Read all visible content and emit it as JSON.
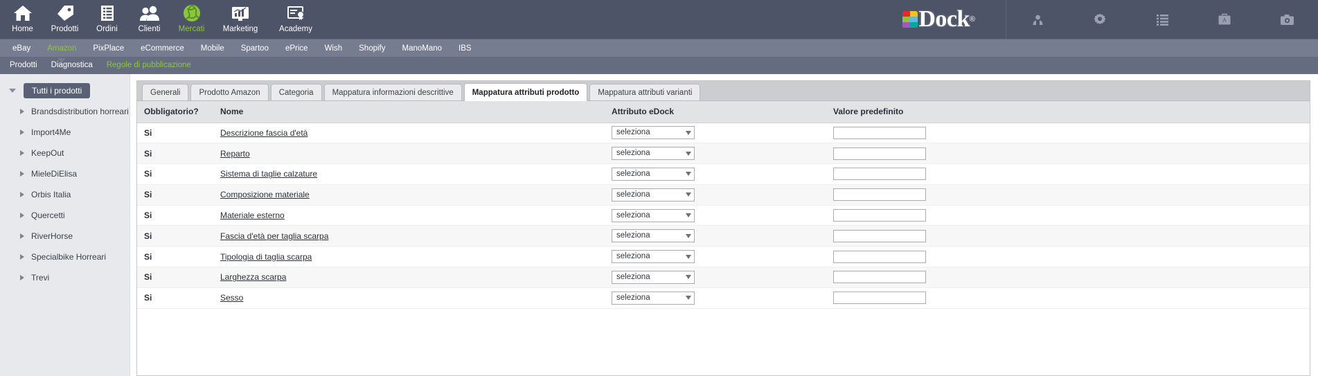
{
  "topnav": {
    "items": [
      {
        "label": "Home",
        "icon": "home-icon",
        "active": false
      },
      {
        "label": "Prodotti",
        "icon": "tag-icon",
        "active": false
      },
      {
        "label": "Ordini",
        "icon": "list-document-icon",
        "active": false
      },
      {
        "label": "Clienti",
        "icon": "users-icon",
        "active": false
      },
      {
        "label": "Mercati",
        "icon": "globe-green-icon",
        "active": true
      },
      {
        "label": "Marketing",
        "icon": "chart-monitor-icon",
        "active": false
      },
      {
        "label": "Academy",
        "icon": "certificate-icon",
        "active": false
      }
    ],
    "logo": {
      "word": "Dock",
      "registered": "®",
      "tile_colors": [
        "#e8282d",
        "#f6c11a",
        "#8cc63e",
        "#5fb8e8",
        "#a855c4",
        "#00a99d"
      ]
    },
    "right_icons": [
      {
        "name": "user-account-icon"
      },
      {
        "name": "gear-settings-icon"
      },
      {
        "name": "list-menu-icon"
      },
      {
        "name": "briefcase-icon"
      },
      {
        "name": "camera-icon"
      }
    ]
  },
  "marketnav": {
    "items": [
      {
        "label": "eBay",
        "active": false
      },
      {
        "label": "Amazon",
        "active": true
      },
      {
        "label": "PixPlace",
        "active": false
      },
      {
        "label": "eCommerce",
        "active": false
      },
      {
        "label": "Mobile",
        "active": false
      },
      {
        "label": "Spartoo",
        "active": false
      },
      {
        "label": "ePrice",
        "active": false
      },
      {
        "label": "Wish",
        "active": false
      },
      {
        "label": "Shopify",
        "active": false
      },
      {
        "label": "ManoMano",
        "active": false
      },
      {
        "label": "IBS",
        "active": false
      }
    ]
  },
  "subnav": {
    "items": [
      {
        "label": "Prodotti",
        "active": false
      },
      {
        "label": "Diagnostica",
        "active": false
      },
      {
        "label": "Regole di pubblicazione",
        "active": true
      }
    ]
  },
  "sidebar": {
    "root": {
      "label": "Tutti i prodotti",
      "expanded": true
    },
    "items": [
      {
        "label": "Brandsdistribution horreari"
      },
      {
        "label": "Import4Me"
      },
      {
        "label": "KeepOut"
      },
      {
        "label": "MieleDiElisa"
      },
      {
        "label": "Orbis Italia"
      },
      {
        "label": "Quercetti"
      },
      {
        "label": "RiverHorse"
      },
      {
        "label": "Specialbike Horreari"
      },
      {
        "label": "Trevi"
      }
    ]
  },
  "tabs": [
    {
      "label": "Generali",
      "active": false
    },
    {
      "label": "Prodotto Amazon",
      "active": false
    },
    {
      "label": "Categoria",
      "active": false
    },
    {
      "label": "Mappatura informazioni descrittive",
      "active": false
    },
    {
      "label": "Mappatura attributi prodotto",
      "active": true
    },
    {
      "label": "Mappatura attributi varianti",
      "active": false
    }
  ],
  "table": {
    "columns": [
      "Obbligatorio?",
      "Nome",
      "Attributo eDock",
      "Valore predefinito"
    ],
    "select_placeholder": "seleziona",
    "default_value": "",
    "rows": [
      {
        "required": "Si",
        "name": "Descrizione fascia d'età",
        "attribute": "seleziona",
        "value": ""
      },
      {
        "required": "Si",
        "name": "Reparto",
        "attribute": "seleziona",
        "value": ""
      },
      {
        "required": "Si",
        "name": "Sistema di taglie calzature",
        "attribute": "seleziona",
        "value": ""
      },
      {
        "required": "Si",
        "name": "Composizione materiale",
        "attribute": "seleziona",
        "value": ""
      },
      {
        "required": "Si",
        "name": "Materiale esterno",
        "attribute": "seleziona",
        "value": ""
      },
      {
        "required": "Si",
        "name": "Fascia d'età per taglia scarpa",
        "attribute": "seleziona",
        "value": ""
      },
      {
        "required": "Si",
        "name": "Tipologia di taglia scarpa",
        "attribute": "seleziona",
        "value": ""
      },
      {
        "required": "Si",
        "name": "Larghezza scarpa",
        "attribute": "seleziona",
        "value": ""
      },
      {
        "required": "Si",
        "name": "Sesso",
        "attribute": "seleziona",
        "value": ""
      }
    ]
  },
  "colors": {
    "nav_bg": "#4e5468",
    "market_bg": "#777d91",
    "sub_bg": "#666c80",
    "accent_green": "#8cc63e",
    "sidebar_bg": "#e8e9ed",
    "tab_strip": "#cccdd1"
  }
}
